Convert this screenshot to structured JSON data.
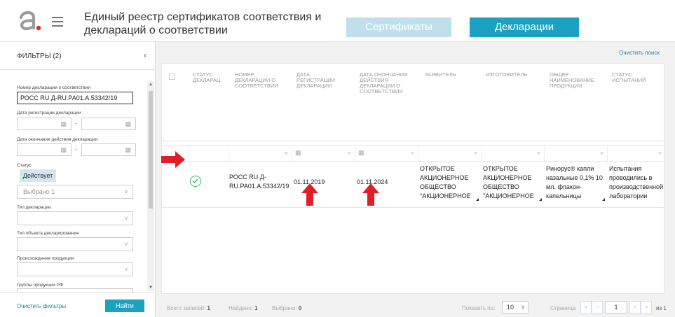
{
  "header": {
    "title": "Единый реестр сертификатов соответствия и деклараций о соответствии",
    "tabs": [
      {
        "label": "Сертификаты",
        "active": false
      },
      {
        "label": "Декларации",
        "active": true
      }
    ],
    "accent": "#1ca2c0",
    "logo_color": "#e4262b"
  },
  "sidebar": {
    "title": "ФИЛЬТРЫ (2)",
    "fields": {
      "decl_number_label": "Номер декларации о соответствии",
      "decl_number_value": "РОСС RU Д-RU.PA01.A.53342/19",
      "reg_date_label": "Дата регистрации декларации",
      "end_date_label": "Дата окончания действия декларации",
      "status_label": "Статус",
      "status_value": "Действует",
      "status_selected": "Выбрано 1",
      "decl_type_label": "Тип декларации",
      "object_type_label": "Тип объекта декларирования",
      "origin_label": "Происхождение продукции",
      "groups_label": "Группы продукции РФ",
      "date_separator": "-"
    },
    "footer": {
      "clear": "Очистить фильтры",
      "find": "Найти"
    }
  },
  "main": {
    "clear_search": "Очистить поиск",
    "columns": [
      "СТАТУС ДЕКЛАРАЦ",
      "НОМЕР ДЕКЛАРАЦИИ О СООТВЕТСТВИИ",
      "ДАТА РЕГИСТРАЦИИ ДЕКЛАРАЦИИ",
      "ДАТА ОКОНЧАНИЯ ДЕЙСТВИЯ ДЕКЛАРАЦИИ О СООТВЕТСТВИИ",
      "ЗАЯВИТЕЛЬ",
      "ИЗГОТОВИТЕЛЬ",
      "ОБЩЕЕ НАИМЕНОВАНИЕ ПРОДУКЦИИ",
      "СТАТУС ИСПЫТАНИЙ"
    ],
    "rows": [
      {
        "number": "РОСС RU Д-RU.PA01.A.53342/19",
        "reg_date": "01.11.2019",
        "end_date": "01.11.2024",
        "applicant": "ОТКРЫТОЕ АКЦИОНЕРНОЕ ОБЩЕСТВО \"АКЦИОНЕРНОЕ",
        "manufacturer": "ОТКРЫТОЕ АКЦИОНЕРНОЕ ОБЩЕСТВО \"АКЦИОНЕРНОЕ",
        "product": "Ринорус® капли назальные 0,1% 10 мл, флакон-капельницы",
        "tests": "Испытания проводились в производственной лаборатории",
        "status_color": "#3cb371"
      }
    ],
    "footer": {
      "total_label": "Всего записей:",
      "total_value": "1",
      "found_label": "Найдено:",
      "found_value": "1",
      "selected_label": "Выбрано:",
      "selected_value": "0",
      "show_label": "Показать по:",
      "page_size": "10",
      "page_label": "Страница",
      "page_value": "1",
      "page_of": "из 1"
    }
  },
  "annotation": {
    "arrow_color": "#e01e26"
  }
}
